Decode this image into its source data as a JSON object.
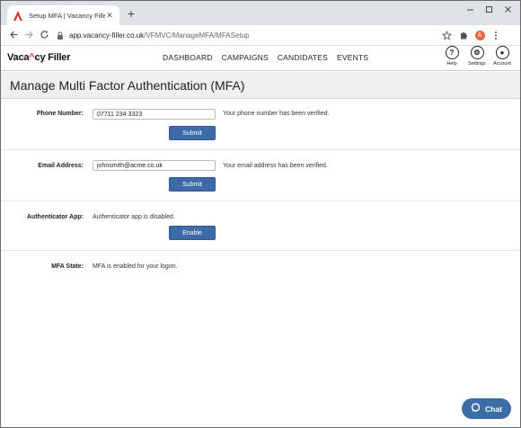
{
  "browser": {
    "tab_title": "Setup MFA | Vacancy Filler",
    "tab_close": "✕",
    "new_tab": "+",
    "url_host": "app.vacancy-filler.co.uk",
    "url_path": "/VFMVC/ManageMFA/MFASetup",
    "profile_initial": "A"
  },
  "header": {
    "logo_pre": "Vaca",
    "logo_caret": "^",
    "logo_post": "cy Filler",
    "nav": [
      "DASHBOARD",
      "CAMPAIGNS",
      "CANDIDATES",
      "EVENTS"
    ],
    "tools": [
      {
        "label": "Help",
        "glyph": "?"
      },
      {
        "label": "Settings",
        "glyph": "⚙"
      },
      {
        "label": "Account",
        "glyph": "●"
      }
    ]
  },
  "page": {
    "title": "Manage Multi Factor Authentication (MFA)"
  },
  "phone": {
    "label": "Phone Number:",
    "value": "07711 234 3323",
    "status": "Your phone number has been verified.",
    "submit_label": "Submit"
  },
  "email": {
    "label": "Email Address:",
    "value": "johnsmith@acme.co.uk",
    "status": "Your email address has been verified.",
    "submit_label": "Submit"
  },
  "authenticator": {
    "label": "Authenticator App:",
    "status": "Authenticator app is disabled.",
    "enable_label": "Enable"
  },
  "mfa_state": {
    "label": "MFA State:",
    "status": "MFA is enabled for your logon."
  },
  "chat": {
    "label": "Chat"
  }
}
